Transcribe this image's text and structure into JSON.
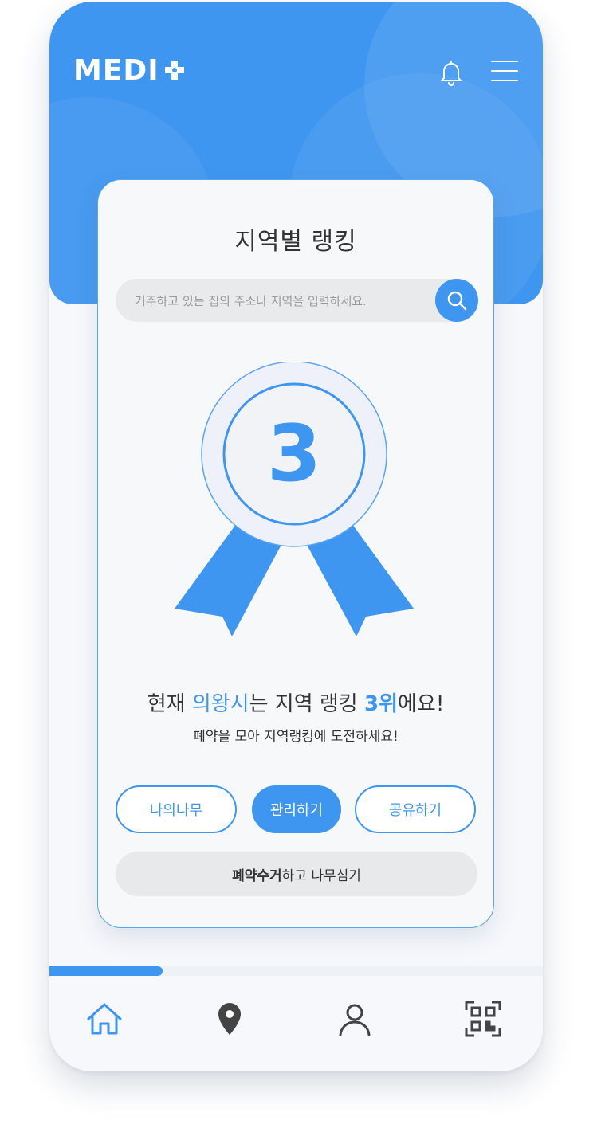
{
  "app": {
    "logo_text": "MEDI",
    "logo_suffix_icon": "plus-icon"
  },
  "header": {
    "icons": [
      "bell-icon",
      "menu-icon"
    ]
  },
  "ranking_card": {
    "title": "지역별 랭킹",
    "search": {
      "placeholder": "거주하고 있는 집의 주소나 지역을 입력하세요.",
      "value": "",
      "button_icon": "search-icon"
    },
    "rank": "3",
    "headline": {
      "prefix": "현재 ",
      "city": "의왕시",
      "middle": "는 지역 랭킹 ",
      "rank_text": "3위",
      "suffix": "에요!"
    },
    "subline": "폐약을 모아 지역랭킹에 도전하세요!",
    "buttons": {
      "my_tree": "나의나무",
      "manage": "관리하기",
      "share": "공유하기"
    },
    "collect_button": {
      "bold": "폐약수거",
      "rest": "하고 나무심기"
    }
  },
  "progress": 0.23,
  "bottom_nav": {
    "items": [
      {
        "icon": "home-icon",
        "active": true
      },
      {
        "icon": "location-pin-icon",
        "active": false
      },
      {
        "icon": "user-icon",
        "active": false
      },
      {
        "icon": "qr-code-icon",
        "active": false
      }
    ]
  },
  "colors": {
    "primary": "#3f96f0",
    "background": "#f6f8fb",
    "text": "#333333",
    "muted_button": "#e8e9eb"
  }
}
